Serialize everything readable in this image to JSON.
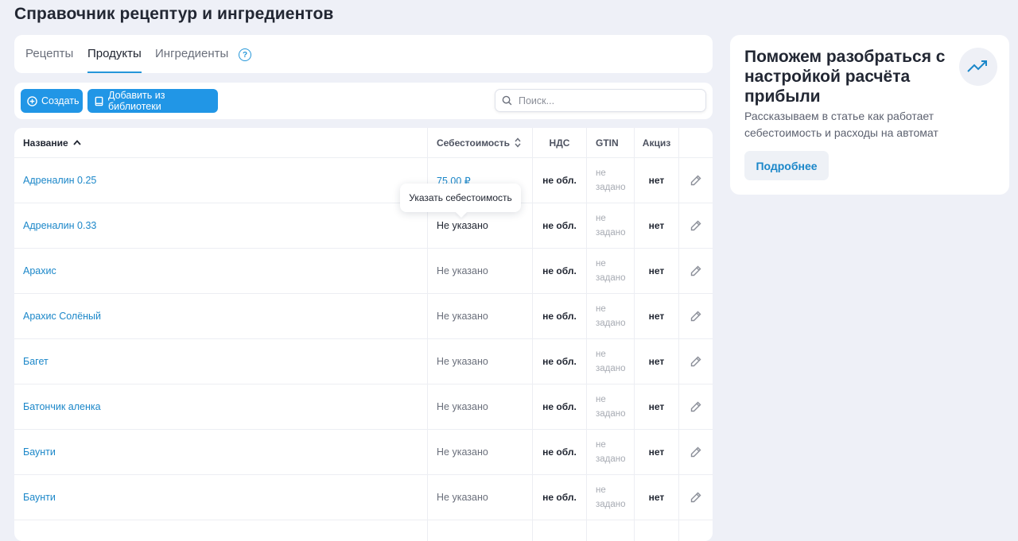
{
  "page_title": "Справочник рецептур и ингредиентов",
  "tabs": [
    {
      "label": "Рецепты",
      "active": false
    },
    {
      "label": "Продукты",
      "active": true
    },
    {
      "label": "Ингредиенты",
      "active": false
    }
  ],
  "help_icon_glyph": "?",
  "toolbar": {
    "create_label": "Создать",
    "library_label": "Добавить из библиотеки",
    "search_placeholder": "Поиск..."
  },
  "table": {
    "headers": {
      "name": "Название",
      "cost": "Себестоимость",
      "vat": "НДС",
      "gtin": "GTIN",
      "excise": "Акциз"
    },
    "rows": [
      {
        "name": "Адреналин 0.25",
        "cost": "75,00 ₽",
        "vat": "не обл.",
        "gtin": "не задано",
        "excise": "нет"
      },
      {
        "name": "Адреналин 0.33",
        "cost": "Не указано",
        "vat": "не обл.",
        "gtin": "не задано",
        "excise": "нет"
      },
      {
        "name": "Арахис",
        "cost": "Не указано",
        "vat": "не обл.",
        "gtin": "не задано",
        "excise": "нет"
      },
      {
        "name": "Арахис Солёный",
        "cost": "Не указано",
        "vat": "не обл.",
        "gtin": "не задано",
        "excise": "нет"
      },
      {
        "name": "Багет",
        "cost": "Не указано",
        "vat": "не обл.",
        "gtin": "не задано",
        "excise": "нет"
      },
      {
        "name": "Батончик аленка",
        "cost": "Не указано",
        "vat": "не обл.",
        "gtin": "не задано",
        "excise": "нет"
      },
      {
        "name": "Баунти",
        "cost": "Не указано",
        "vat": "не обл.",
        "gtin": "не задано",
        "excise": "нет"
      },
      {
        "name": "Баунти",
        "cost": "Не указано",
        "vat": "не обл.",
        "gtin": "не задано",
        "excise": "нет"
      }
    ]
  },
  "tooltip": "Указать себестоимость",
  "promo": {
    "title": "Поможем разобраться с настройкой расчёта прибыли",
    "text": "Рассказываем в статье как работает себестоимость и расходы на автомат",
    "button_label": "Подробнее"
  },
  "colors": {
    "accent": "#2196e6",
    "link": "#1b87c9",
    "background": "#eef0f7"
  },
  "icons": [
    "help-icon",
    "plus-circle-icon",
    "book-icon",
    "search-icon",
    "sort-asc-icon",
    "sort-both-icon",
    "pencil-icon",
    "trend-up-icon"
  ]
}
